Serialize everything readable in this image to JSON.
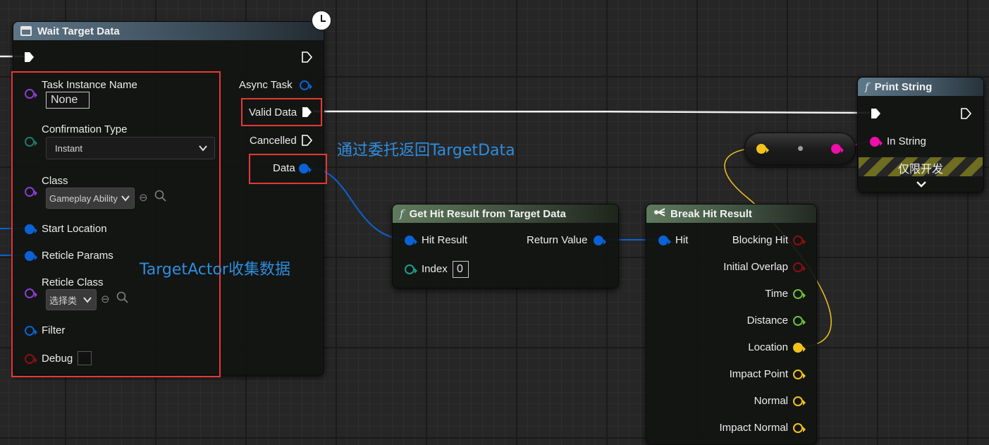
{
  "wait_target_data": {
    "title": "Wait Target Data",
    "inputs": {
      "task_instance_name": {
        "label": "Task Instance Name",
        "value": "None"
      },
      "confirmation_type": {
        "label": "Confirmation Type",
        "value": "Instant"
      },
      "class": {
        "label": "Class",
        "value": "Gameplay Ability"
      },
      "start_location": {
        "label": "Start Location"
      },
      "reticle_params": {
        "label": "Reticle Params"
      },
      "reticle_class": {
        "label": "Reticle Class",
        "value": "选择类"
      },
      "filter": {
        "label": "Filter"
      },
      "debug": {
        "label": "Debug"
      }
    },
    "outputs": {
      "async_task": "Async Task",
      "valid_data": "Valid Data",
      "cancelled": "Cancelled",
      "data": "Data"
    }
  },
  "get_hit_result": {
    "title": "Get Hit Result from Target Data",
    "hit_result": "Hit Result",
    "return_value": "Return Value",
    "index_label": "Index",
    "index_value": "0"
  },
  "break_hit_result": {
    "title": "Break Hit Result",
    "hit": "Hit",
    "outputs": [
      "Blocking Hit",
      "Initial Overlap",
      "Time",
      "Distance",
      "Location",
      "Impact Point",
      "Normal",
      "Impact Normal"
    ]
  },
  "print_string": {
    "title": "Print String",
    "in_string": "In String",
    "dev_only": "仅限开发"
  },
  "annotations": {
    "delegate_note": "通过委托返回TargetData",
    "target_actor_note": "TargetActor收集数据"
  },
  "colors": {
    "exec": "#ffffff",
    "struct": "#0b62d6",
    "object_class": "#8a3dd0",
    "byte_enum": "#1e7a6c",
    "boolean": "#8a1010",
    "float": "#6cc23d",
    "vector": "#f3c21d",
    "string": "#ee0fa8",
    "annotation_blue": "#2e8ddc",
    "annotation_red": "#e53935"
  }
}
